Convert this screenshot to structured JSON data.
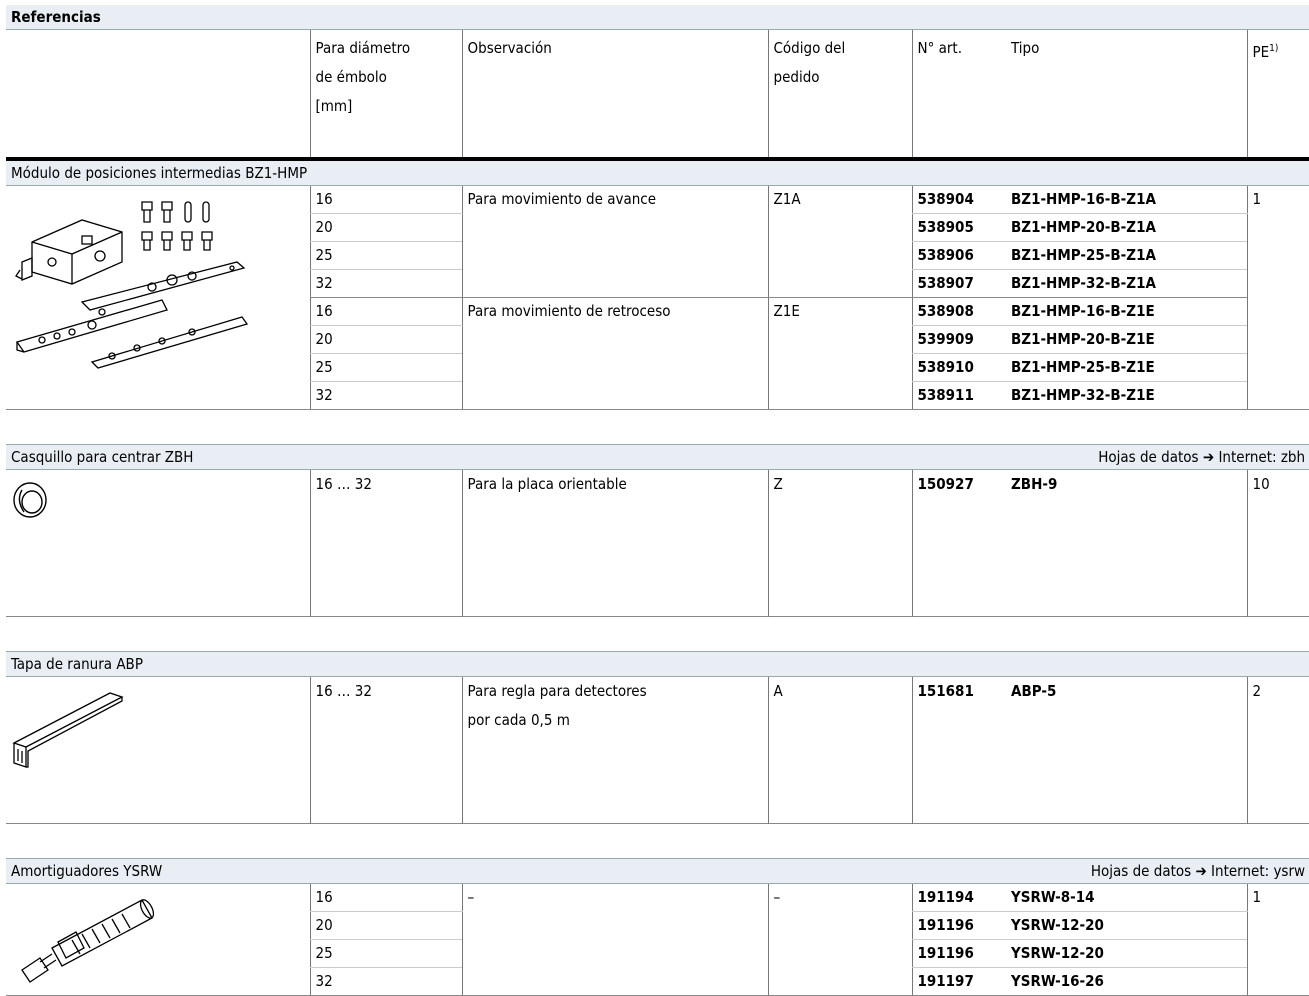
{
  "title": "Referencias",
  "headers": {
    "diameter": [
      "Para diámetro",
      "de émbolo",
      "[mm]"
    ],
    "observation": "Observación",
    "order_code": [
      "Código del",
      "pedido"
    ],
    "part_no": "N° art.",
    "type": "Tipo",
    "pe": "PE",
    "pe_sup": "1)"
  },
  "sections": {
    "bz1": {
      "title": "Módulo de posiciones intermedias BZ1-HMP",
      "rows": [
        {
          "dia": "16",
          "obs": "Para movimiento de avance",
          "code": "Z1A",
          "art": "538904",
          "type": "BZ1-HMP-16-B-Z1A",
          "pe": "1"
        },
        {
          "dia": "20",
          "art": "538905",
          "type": "BZ1-HMP-20-B-Z1A"
        },
        {
          "dia": "25",
          "art": "538906",
          "type": "BZ1-HMP-25-B-Z1A"
        },
        {
          "dia": "32",
          "art": "538907",
          "type": "BZ1-HMP-32-B-Z1A"
        },
        {
          "dia": "16",
          "obs": "Para movimiento de retroceso",
          "code": "Z1E",
          "art": "538908",
          "type": "BZ1-HMP-16-B-Z1E"
        },
        {
          "dia": "20",
          "art": "539909",
          "type": "BZ1-HMP-20-B-Z1E"
        },
        {
          "dia": "25",
          "art": "538910",
          "type": "BZ1-HMP-25-B-Z1E"
        },
        {
          "dia": "32",
          "art": "538911",
          "type": "BZ1-HMP-32-B-Z1E"
        }
      ]
    },
    "zbh": {
      "title": "Casquillo para centrar ZBH",
      "link": "Hojas de datos ➔ Internet: zbh",
      "row": {
        "dia": "16 … 32",
        "obs": "Para la placa orientable",
        "code": "Z",
        "art": "150927",
        "type": "ZBH-9",
        "pe": "10"
      }
    },
    "abp": {
      "title": "Tapa de ranura ABP",
      "row": {
        "dia": "16 … 32",
        "obs1": "Para regla para detectores",
        "obs2": "por cada 0,5 m",
        "code": "A",
        "art": "151681",
        "type": "ABP-5",
        "pe": "2"
      }
    },
    "ysrw": {
      "title": "Amortiguadores YSRW",
      "link": "Hojas de datos ➔ Internet: ysrw",
      "obs": "–",
      "code": "–",
      "pe": "1",
      "rows": [
        {
          "dia": "16",
          "art": "191194",
          "type": "YSRW-8-14"
        },
        {
          "dia": "20",
          "art": "191196",
          "type": "YSRW-12-20"
        },
        {
          "dia": "25",
          "art": "191196",
          "type": "YSRW-12-20"
        },
        {
          "dia": "32",
          "art": "191197",
          "type": "YSRW-16-26"
        }
      ]
    }
  }
}
